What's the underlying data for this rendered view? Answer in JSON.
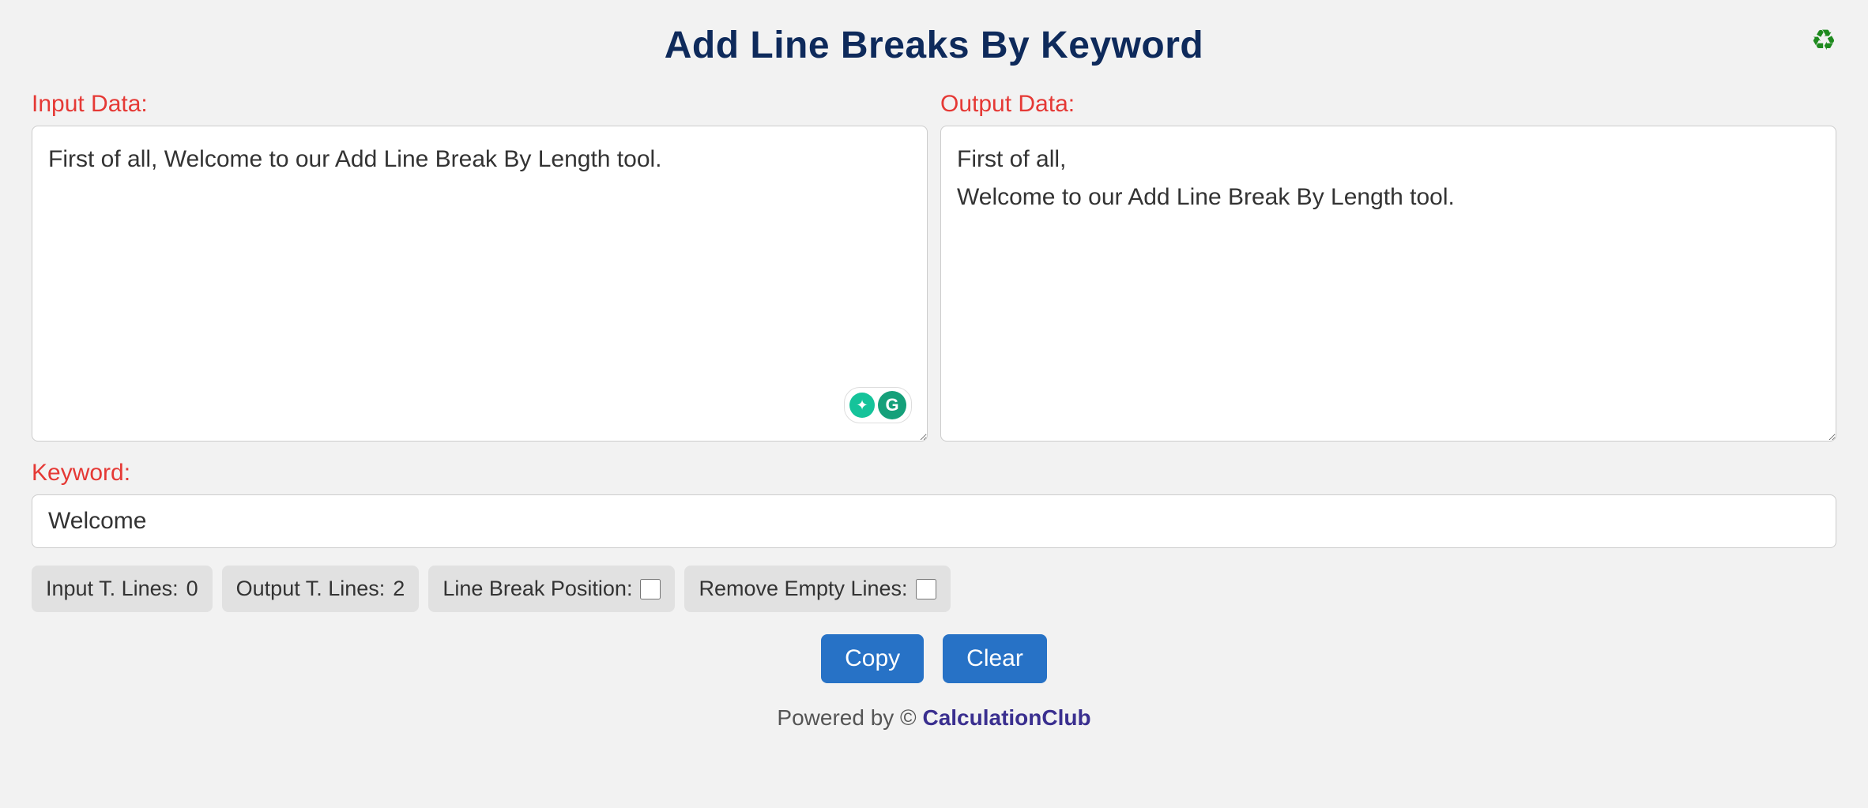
{
  "title": "Add Line Breaks By Keyword",
  "labels": {
    "input": "Input Data:",
    "output": "Output Data:",
    "keyword": "Keyword:"
  },
  "textareas": {
    "input_value": "First of all, Welcome to our Add Line Break By Length tool.",
    "output_value": "First of all,\nWelcome to our Add Line Break By Length tool."
  },
  "keyword_value": "Welcome",
  "pills": {
    "input_lines_label": "Input T. Lines: ",
    "input_lines_value": "0",
    "output_lines_label": "Output T. Lines: ",
    "output_lines_value": "2",
    "line_break_position": "Line Break Position:",
    "remove_empty_lines": "Remove Empty Lines:"
  },
  "buttons": {
    "copy": "Copy",
    "clear": "Clear"
  },
  "footer": {
    "prefix": "Powered by © ",
    "brand": "CalculationClub"
  },
  "icons": {
    "recycle": "♻",
    "bulb": "✦",
    "g": "G"
  }
}
